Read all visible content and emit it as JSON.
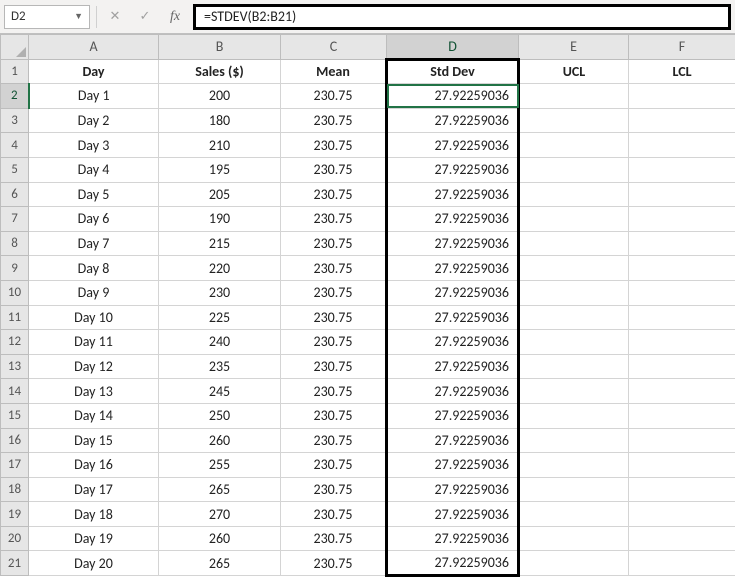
{
  "nameBox": "D2",
  "formula": "=STDEV(B2:B21)",
  "columns": [
    "A",
    "B",
    "C",
    "D",
    "E",
    "F"
  ],
  "activeCol": "D",
  "activeRow": 2,
  "headers": {
    "A": "Day",
    "B": "Sales ($)",
    "C": "Mean",
    "D": "Std Dev",
    "E": "UCL",
    "F": "LCL"
  },
  "rows": [
    {
      "n": 2,
      "day": "Day 1",
      "sales": "200",
      "mean": "230.75",
      "std": "27.92259036"
    },
    {
      "n": 3,
      "day": "Day 2",
      "sales": "180",
      "mean": "230.75",
      "std": "27.92259036"
    },
    {
      "n": 4,
      "day": "Day 3",
      "sales": "210",
      "mean": "230.75",
      "std": "27.92259036"
    },
    {
      "n": 5,
      "day": "Day 4",
      "sales": "195",
      "mean": "230.75",
      "std": "27.92259036"
    },
    {
      "n": 6,
      "day": "Day 5",
      "sales": "205",
      "mean": "230.75",
      "std": "27.92259036"
    },
    {
      "n": 7,
      "day": "Day 6",
      "sales": "190",
      "mean": "230.75",
      "std": "27.92259036"
    },
    {
      "n": 8,
      "day": "Day 7",
      "sales": "215",
      "mean": "230.75",
      "std": "27.92259036"
    },
    {
      "n": 9,
      "day": "Day 8",
      "sales": "220",
      "mean": "230.75",
      "std": "27.92259036"
    },
    {
      "n": 10,
      "day": "Day 9",
      "sales": "230",
      "mean": "230.75",
      "std": "27.92259036"
    },
    {
      "n": 11,
      "day": "Day 10",
      "sales": "225",
      "mean": "230.75",
      "std": "27.92259036"
    },
    {
      "n": 12,
      "day": "Day 11",
      "sales": "240",
      "mean": "230.75",
      "std": "27.92259036"
    },
    {
      "n": 13,
      "day": "Day 12",
      "sales": "235",
      "mean": "230.75",
      "std": "27.92259036"
    },
    {
      "n": 14,
      "day": "Day 13",
      "sales": "245",
      "mean": "230.75",
      "std": "27.92259036"
    },
    {
      "n": 15,
      "day": "Day 14",
      "sales": "250",
      "mean": "230.75",
      "std": "27.92259036"
    },
    {
      "n": 16,
      "day": "Day 15",
      "sales": "260",
      "mean": "230.75",
      "std": "27.92259036"
    },
    {
      "n": 17,
      "day": "Day 16",
      "sales": "255",
      "mean": "230.75",
      "std": "27.92259036"
    },
    {
      "n": 18,
      "day": "Day 17",
      "sales": "265",
      "mean": "230.75",
      "std": "27.92259036"
    },
    {
      "n": 19,
      "day": "Day 18",
      "sales": "270",
      "mean": "230.75",
      "std": "27.92259036"
    },
    {
      "n": 20,
      "day": "Day 19",
      "sales": "260",
      "mean": "230.75",
      "std": "27.92259036"
    },
    {
      "n": 21,
      "day": "Day 20",
      "sales": "265",
      "mean": "230.75",
      "std": "27.92259036"
    }
  ]
}
